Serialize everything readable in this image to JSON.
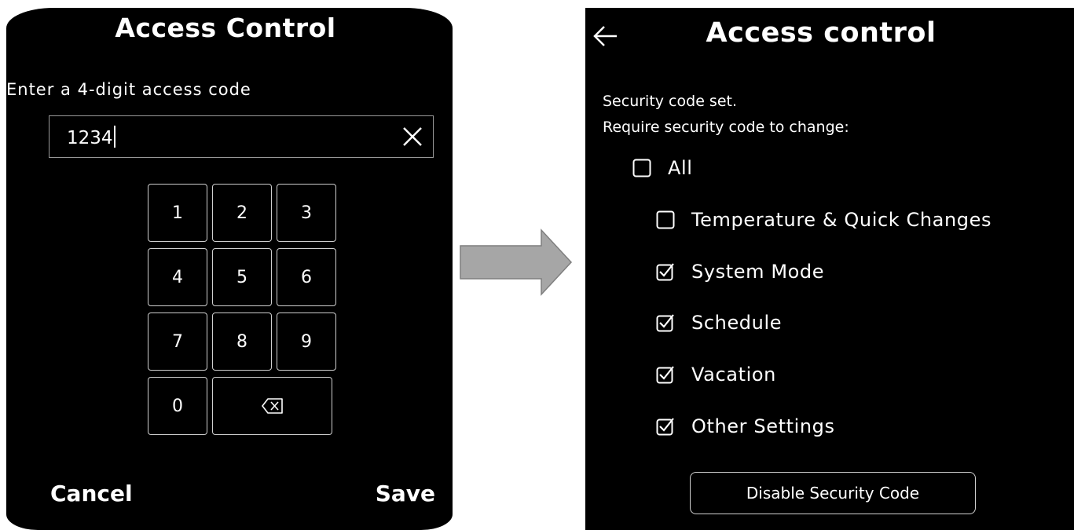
{
  "left_screen": {
    "title": "Access Control",
    "prompt": "Enter a 4-digit access code",
    "code_value": "1234",
    "keypad": [
      "1",
      "2",
      "3",
      "4",
      "5",
      "6",
      "7",
      "8",
      "9",
      "0"
    ],
    "backspace_icon": "backspace-icon",
    "clear_icon": "close-icon",
    "cancel_label": "Cancel",
    "save_label": "Save"
  },
  "right_screen": {
    "back_icon": "arrow-left-icon",
    "title": "Access control",
    "status_line_1": "Security code set.",
    "status_line_2": "Require security code to change:",
    "options": [
      {
        "label": "All",
        "checked": false
      },
      {
        "label": "Temperature & Quick Changes",
        "checked": false
      },
      {
        "label": "System Mode",
        "checked": true
      },
      {
        "label": "Schedule",
        "checked": true
      },
      {
        "label": "Vacation",
        "checked": true
      },
      {
        "label": "Other Settings",
        "checked": true
      }
    ],
    "disable_button_label": "Disable Security Code"
  },
  "colors": {
    "screen_bg": "#000000",
    "text": "#ffffff",
    "border": "#cfcfcf",
    "arrow_fill": "#a6a6a6",
    "arrow_stroke": "#7f7f7f"
  }
}
